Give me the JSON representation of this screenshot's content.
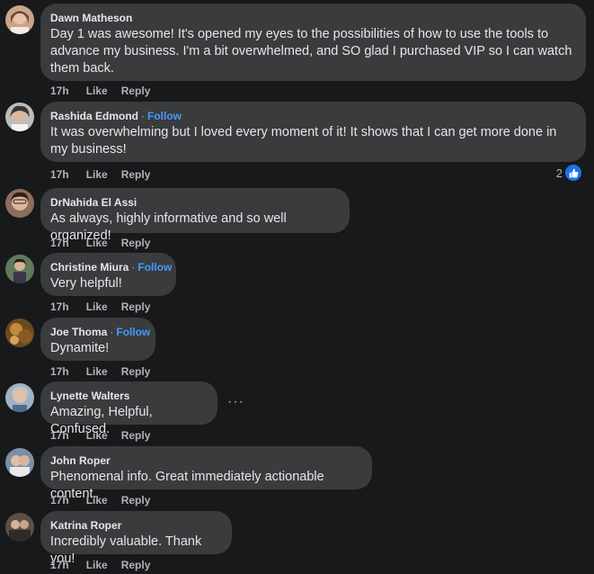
{
  "comments": [
    {
      "author": "Dawn Matheson",
      "follow": "",
      "text": "Day 1 was awesome! It's opened my eyes to the possibilities of how to use the tools to advance my business. I'm a bit overwhelmed, and SO glad I purchased VIP so I can watch them back.",
      "time": "17h",
      "like": "Like",
      "reply": "Reply"
    },
    {
      "author": "Rashida Edmond",
      "follow": "Follow",
      "text": "It was overwhelming but I loved every moment of it! It shows that I can get more done in my business!",
      "time": "17h",
      "like": "Like",
      "reply": "Reply",
      "reaction_count": "2",
      "reaction_icon": "like-icon"
    },
    {
      "author": "DrNahida El Assi",
      "follow": "",
      "text": "As always, highly informative and so well organized!",
      "time": "17h",
      "like": "Like",
      "reply": "Reply"
    },
    {
      "author": "Christine Miura",
      "follow": "Follow",
      "text": "Very helpful!",
      "time": "17h",
      "like": "Like",
      "reply": "Reply"
    },
    {
      "author": "Joe Thoma",
      "follow": "Follow",
      "text": "Dynamite!",
      "time": "17h",
      "like": "Like",
      "reply": "Reply"
    },
    {
      "author": "Lynette Walters",
      "follow": "",
      "text": "Amazing, Helpful, Confused.",
      "time": "17h",
      "like": "Like",
      "reply": "Reply",
      "more": "···"
    },
    {
      "author": "John Roper",
      "follow": "",
      "text": "Phenomenal info. Great immediately actionable content.",
      "time": "17h",
      "like": "Like",
      "reply": "Reply"
    },
    {
      "author": "Katrina Roper",
      "follow": "",
      "text": "Incredibly valuable. Thank you!",
      "time": "17h",
      "like": "Like",
      "reply": "Reply"
    }
  ],
  "separator": "·",
  "colors": {
    "background": "#18191a",
    "bubble": "#3a3b3c",
    "text": "#e4e6eb",
    "secondary": "#b0b3b8",
    "follow": "#4599ff",
    "like_badge": "#1b74e4"
  }
}
